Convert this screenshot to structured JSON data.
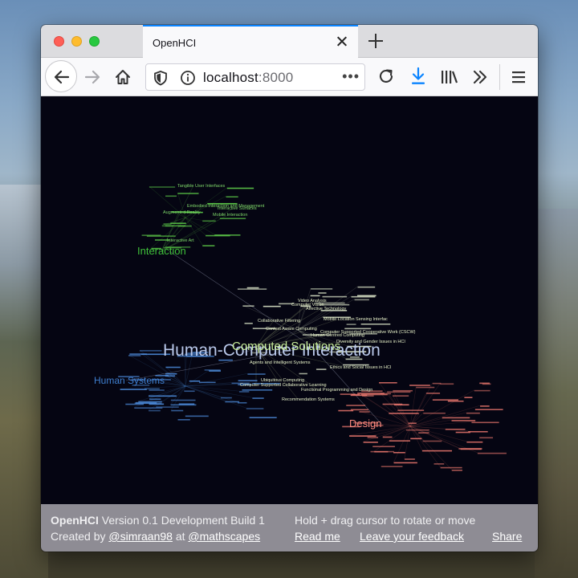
{
  "browser": {
    "tab_title": "OpenHCI",
    "url_host": "localhost",
    "url_port": ":8000",
    "url_more": "•••"
  },
  "graph": {
    "nodes": [
      {
        "label": "Human-Computer Interaction",
        "color": "#b9c8ea",
        "size": 21
      },
      {
        "label": "Computed Solutions",
        "color": "#c8ee9a",
        "size": 15
      },
      {
        "label": "Interaction",
        "color": "#3fc03a",
        "size": 13
      },
      {
        "label": "Human Systems",
        "color": "#3f7fd0",
        "size": 12
      },
      {
        "label": "Design",
        "color": "#ff8c80",
        "size": 13
      }
    ],
    "small_labels": [
      "Video Analysis",
      "Computer Vision",
      "Affective Technology",
      "Mobile Location Sensing Interfac",
      "Collaborative Filtering",
      "Context Aware Computing",
      "Computer Supported Cooperative Work (CSCW)",
      "Human Centred Computing",
      "Diversity and Gender Issues in HCI",
      "Agents and Intelligent Systems",
      "Ethics and Social Issues in HCI",
      "Ubiquitous Computing",
      "Computer Supported Collaborative Learning",
      "Functional Programming and Design",
      "Recommendation Systems",
      "Tangible User Interfaces",
      "Embodied Interaction and Management",
      "Augmented Reality",
      "Interactive Art",
      "Mobile Interaction",
      "Interactive Surfaces"
    ]
  },
  "footer": {
    "app_name": "OpenHCI",
    "version": "Version 0.1 Development Build 1",
    "hint": "Hold + drag cursor to rotate or move",
    "created_by": "Created by",
    "author": "@simraan98",
    "at": "at",
    "org": "@mathscapes",
    "readme": "Read me",
    "feedback": "Leave your feedback",
    "share": "Share"
  },
  "colors": {
    "accent": "#0a84ff",
    "download": "#0a84ff",
    "canvas_bg": "#050512",
    "footer_bg": "#8e8c94"
  },
  "icons": [
    "back-arrow-icon",
    "forward-arrow-icon",
    "home-icon",
    "shield-icon",
    "info-icon",
    "reload-icon",
    "download-icon",
    "library-icon",
    "overflow-chevrons-icon",
    "menu-icon",
    "close-icon",
    "plus-icon"
  ]
}
